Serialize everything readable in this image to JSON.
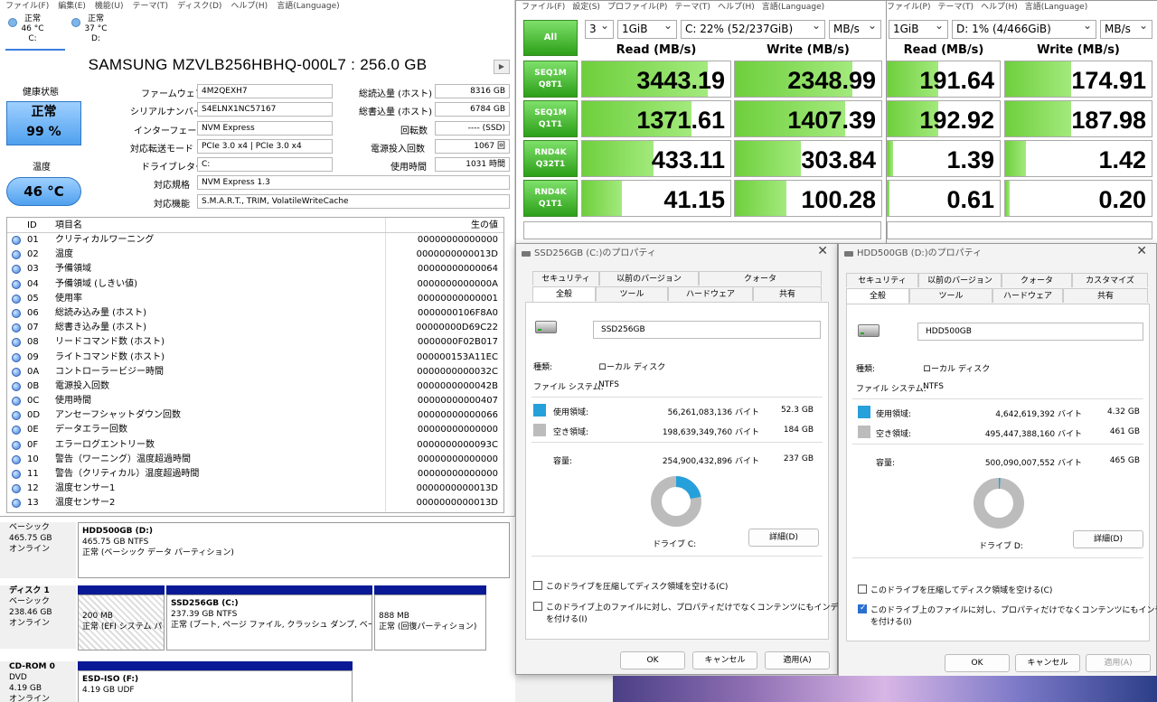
{
  "cdi": {
    "menu": [
      "ファイル(F)",
      "編集(E)",
      "機能(U)",
      "テーマ(T)",
      "ディスク(D)",
      "ヘルプ(H)",
      "言語(Language)"
    ],
    "drives": [
      {
        "status": "正常",
        "temp": "46 °C",
        "letter": "C:"
      },
      {
        "status": "正常",
        "temp": "37 °C",
        "letter": "D:"
      }
    ],
    "model": "SAMSUNG MZVLB256HBHQ-000L7 : 256.0 GB",
    "health_label": "健康状態",
    "health_status": "正常",
    "health_pct": "99 %",
    "temp_label": "温度",
    "temp": "46 °C",
    "fields": {
      "fw_label": "ファームウェア",
      "fw": "4M2QEXH7",
      "sn_label": "シリアルナンバー",
      "sn": "S4ELNX1NC57167",
      "if_label": "インターフェース",
      "if": "NVM Express",
      "mode_label": "対応転送モード",
      "mode": "PCIe 3.0 x4 | PCIe 3.0 x4",
      "letter_label": "ドライブレター",
      "letter": "C:",
      "std_label": "対応規格",
      "std": "NVM Express 1.3",
      "feat_label": "対応機能",
      "feat": "S.M.A.R.T., TRIM, VolatileWriteCache",
      "read_label": "総読込量 (ホスト)",
      "read": "8316 GB",
      "write_label": "総書込量 (ホスト)",
      "write": "6784 GB",
      "rpm_label": "回転数",
      "rpm": "---- (SSD)",
      "pwr_label": "電源投入回数",
      "pwr": "1067 回",
      "hours_label": "使用時間",
      "hours": "1031 時間"
    },
    "smart_headers": {
      "id": "ID",
      "name": "項目名",
      "raw": "生の値"
    },
    "smart_rows": [
      {
        "id": "01",
        "name": "クリティカルワーニング",
        "raw": "00000000000000"
      },
      {
        "id": "02",
        "name": "温度",
        "raw": "0000000000013D"
      },
      {
        "id": "03",
        "name": "予備領域",
        "raw": "00000000000064"
      },
      {
        "id": "04",
        "name": "予備領域 (しきい値)",
        "raw": "0000000000000A"
      },
      {
        "id": "05",
        "name": "使用率",
        "raw": "00000000000001"
      },
      {
        "id": "06",
        "name": "総読み込み量 (ホスト)",
        "raw": "0000000106F8A0"
      },
      {
        "id": "07",
        "name": "総書き込み量 (ホスト)",
        "raw": "00000000D69C22"
      },
      {
        "id": "08",
        "name": "リードコマンド数 (ホスト)",
        "raw": "0000000F02B017"
      },
      {
        "id": "09",
        "name": "ライトコマンド数 (ホスト)",
        "raw": "000000153A11EC"
      },
      {
        "id": "0A",
        "name": "コントローラービジー時間",
        "raw": "0000000000032C"
      },
      {
        "id": "0B",
        "name": "電源投入回数",
        "raw": "0000000000042B"
      },
      {
        "id": "0C",
        "name": "使用時間",
        "raw": "00000000000407"
      },
      {
        "id": "0D",
        "name": "アンセーフシャットダウン回数",
        "raw": "00000000000066"
      },
      {
        "id": "0E",
        "name": "データエラー回数",
        "raw": "00000000000000"
      },
      {
        "id": "0F",
        "name": "エラーログエントリー数",
        "raw": "0000000000093C"
      },
      {
        "id": "10",
        "name": "警告（ワーニング）温度超過時間",
        "raw": "00000000000000"
      },
      {
        "id": "11",
        "name": "警告（クリティカル）温度超過時間",
        "raw": "00000000000000"
      },
      {
        "id": "12",
        "name": "温度センサー1",
        "raw": "0000000000013D"
      },
      {
        "id": "13",
        "name": "温度センサー2",
        "raw": "0000000000013D"
      }
    ]
  },
  "dm": {
    "d0_label": [
      "ベーシック",
      "465.75 GB",
      "オンライン"
    ],
    "d0_part": [
      "HDD500GB (D:)",
      "465.75 GB NTFS",
      "正常 (ベーシック データ パーティション)"
    ],
    "d1_label": [
      "ディスク 1",
      "ベーシック",
      "238.46 GB",
      "オンライン"
    ],
    "d1_parts": [
      [
        "200 MB",
        "正常 (EFI システム パ"
      ],
      [
        "SSD256GB (C:)",
        "237.39 GB NTFS",
        "正常 (ブート, ページ ファイル, クラッシュ ダンプ, ベーシッ"
      ],
      [
        "888 MB",
        "正常 (回復パーティション)"
      ]
    ],
    "cd_label": [
      "CD-ROM 0",
      "DVD",
      "4.19 GB",
      "オンライン"
    ],
    "cd_part": [
      "ESD-ISO (F:)",
      "4.19 GB UDF"
    ]
  },
  "cdm1": {
    "menu": [
      "ファイル(F)",
      "設定(S)",
      "プロファイル(P)",
      "テーマ(T)",
      "ヘルプ(H)",
      "言語(Language)"
    ],
    "all": "All",
    "count": "3",
    "size": "1GiB",
    "drive": "C: 22% (52/237GiB)",
    "unit": "MB/s",
    "read_h": "Read (MB/s)",
    "write_h": "Write (MB/s)",
    "tests": [
      [
        "SEQ1M",
        "Q8T1"
      ],
      [
        "SEQ1M",
        "Q1T1"
      ],
      [
        "RND4K",
        "Q32T1"
      ],
      [
        "RND4K",
        "Q1T1"
      ]
    ],
    "read": [
      "3443.19",
      "1371.61",
      "433.11",
      "41.15"
    ],
    "write": [
      "2348.99",
      "1407.39",
      "303.84",
      "100.28"
    ],
    "read_frac": [
      0.85,
      0.74,
      0.48,
      0.27
    ],
    "write_frac": [
      0.8,
      0.75,
      0.45,
      0.35
    ]
  },
  "cdm2": {
    "menu": [
      "プロファイル(P)",
      "テーマ(T)",
      "ヘルプ(H)",
      "言語(Language)"
    ],
    "size": "1GiB",
    "drive": "D: 1% (4/466GiB)",
    "unit": "MB/s",
    "read_h": "Read (MB/s)",
    "write_h": "Write (MB/s)",
    "read": [
      "191.64",
      "192.92",
      "1.39",
      "0.61"
    ],
    "write": [
      "174.91",
      "187.98",
      "1.42",
      "0.20"
    ],
    "read_frac": [
      0.45,
      0.45,
      0.05,
      0.02
    ],
    "write_frac": [
      0.45,
      0.45,
      0.14,
      0.03
    ]
  },
  "p1": {
    "title": "SSD256GB (C:)のプロパティ",
    "tabs_top": [
      "セキュリティ",
      "以前のバージョン",
      "クォータ"
    ],
    "tabs_bot": [
      "全般",
      "ツール",
      "ハードウェア",
      "共有"
    ],
    "name": "SSD256GB",
    "type_l": "種類:",
    "type": "ローカル ディスク",
    "fs_l": "ファイル システム:",
    "fs": "NTFS",
    "used_l": "使用領域:",
    "used_b": "56,261,083,136 バイト",
    "used_g": "52.3 GB",
    "free_l": "空き領域:",
    "free_b": "198,639,349,760 バイト",
    "free_g": "184 GB",
    "cap_l": "容量:",
    "cap_b": "254,900,432,896 バイト",
    "cap_g": "237 GB",
    "used_frac": 0.22,
    "drive_l": "ドライブ C:",
    "detail": "詳細(D)",
    "chk1": "このドライブを圧縮してディスク領域を空ける(C)",
    "chk2a": "このドライブ上のファイルに対し、プロパティだけでなくコンテンツにもインデックス",
    "chk2b": "を付ける(I)",
    "ok": "OK",
    "cancel": "キャンセル",
    "apply": "適用(A)"
  },
  "p2": {
    "title": "HDD500GB (D:)のプロパティ",
    "tabs_top": [
      "セキュリティ",
      "以前のバージョン",
      "クォータ",
      "カスタマイズ"
    ],
    "tabs_bot": [
      "全般",
      "ツール",
      "ハードウェア",
      "共有"
    ],
    "name": "HDD500GB",
    "type_l": "種類:",
    "type": "ローカル ディスク",
    "fs_l": "ファイル システム:",
    "fs": "NTFS",
    "used_l": "使用領域:",
    "used_b": "4,642,619,392 バイト",
    "used_g": "4.32 GB",
    "free_l": "空き領域:",
    "free_b": "495,447,388,160 バイト",
    "free_g": "461 GB",
    "cap_l": "容量:",
    "cap_b": "500,090,007,552 バイト",
    "cap_g": "465 GB",
    "used_frac": 0.01,
    "drive_l": "ドライブ D:",
    "detail": "詳細(D)",
    "chk1": "このドライブを圧縮してディスク領域を空ける(C)",
    "chk2a": "このドライブ上のファイルに対し、プロパティだけでなくコンテンツにもインデックス",
    "chk2b": "を付ける(I)",
    "ok": "OK",
    "cancel": "キャンセル",
    "apply": "適用(A)"
  },
  "colors": {
    "used": "#26a0da",
    "free": "#bcbcbc",
    "green": "#6ecf3c"
  }
}
